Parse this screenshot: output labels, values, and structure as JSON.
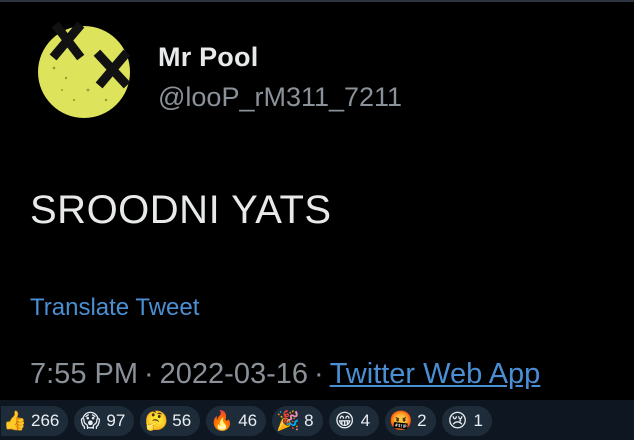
{
  "tweet": {
    "display_name": "Mr Pool",
    "handle": "@looP_rM311_7211",
    "text": "SROODNI YATS",
    "translate_label": "Translate Tweet",
    "time": "7:55 PM",
    "date": "2022-03-16",
    "separator": "·",
    "source": "Twitter Web App",
    "avatar_icon": "yellow-face-x-eyes-icon",
    "colors": {
      "background": "#000000",
      "name": "#e7e9ea",
      "secondary": "#8a9198",
      "link": "#4a8fd4",
      "avatar_yellow": "#dde35a"
    }
  },
  "reactions": [
    {
      "icon": "thumbs-up-icon",
      "emoji": "👍",
      "count": "266"
    },
    {
      "icon": "screaming-face-icon",
      "emoji": "😱",
      "count": "97"
    },
    {
      "icon": "thinking-face-icon",
      "emoji": "🤔",
      "count": "56"
    },
    {
      "icon": "fire-icon",
      "emoji": "🔥",
      "count": "46"
    },
    {
      "icon": "party-popper-icon",
      "emoji": "🎉",
      "count": "8"
    },
    {
      "icon": "grinning-face-icon",
      "emoji": "😁",
      "count": "4"
    },
    {
      "icon": "swearing-face-icon",
      "emoji": "🤬",
      "count": "2"
    },
    {
      "icon": "crying-face-icon",
      "emoji": "😢",
      "count": "1"
    }
  ]
}
